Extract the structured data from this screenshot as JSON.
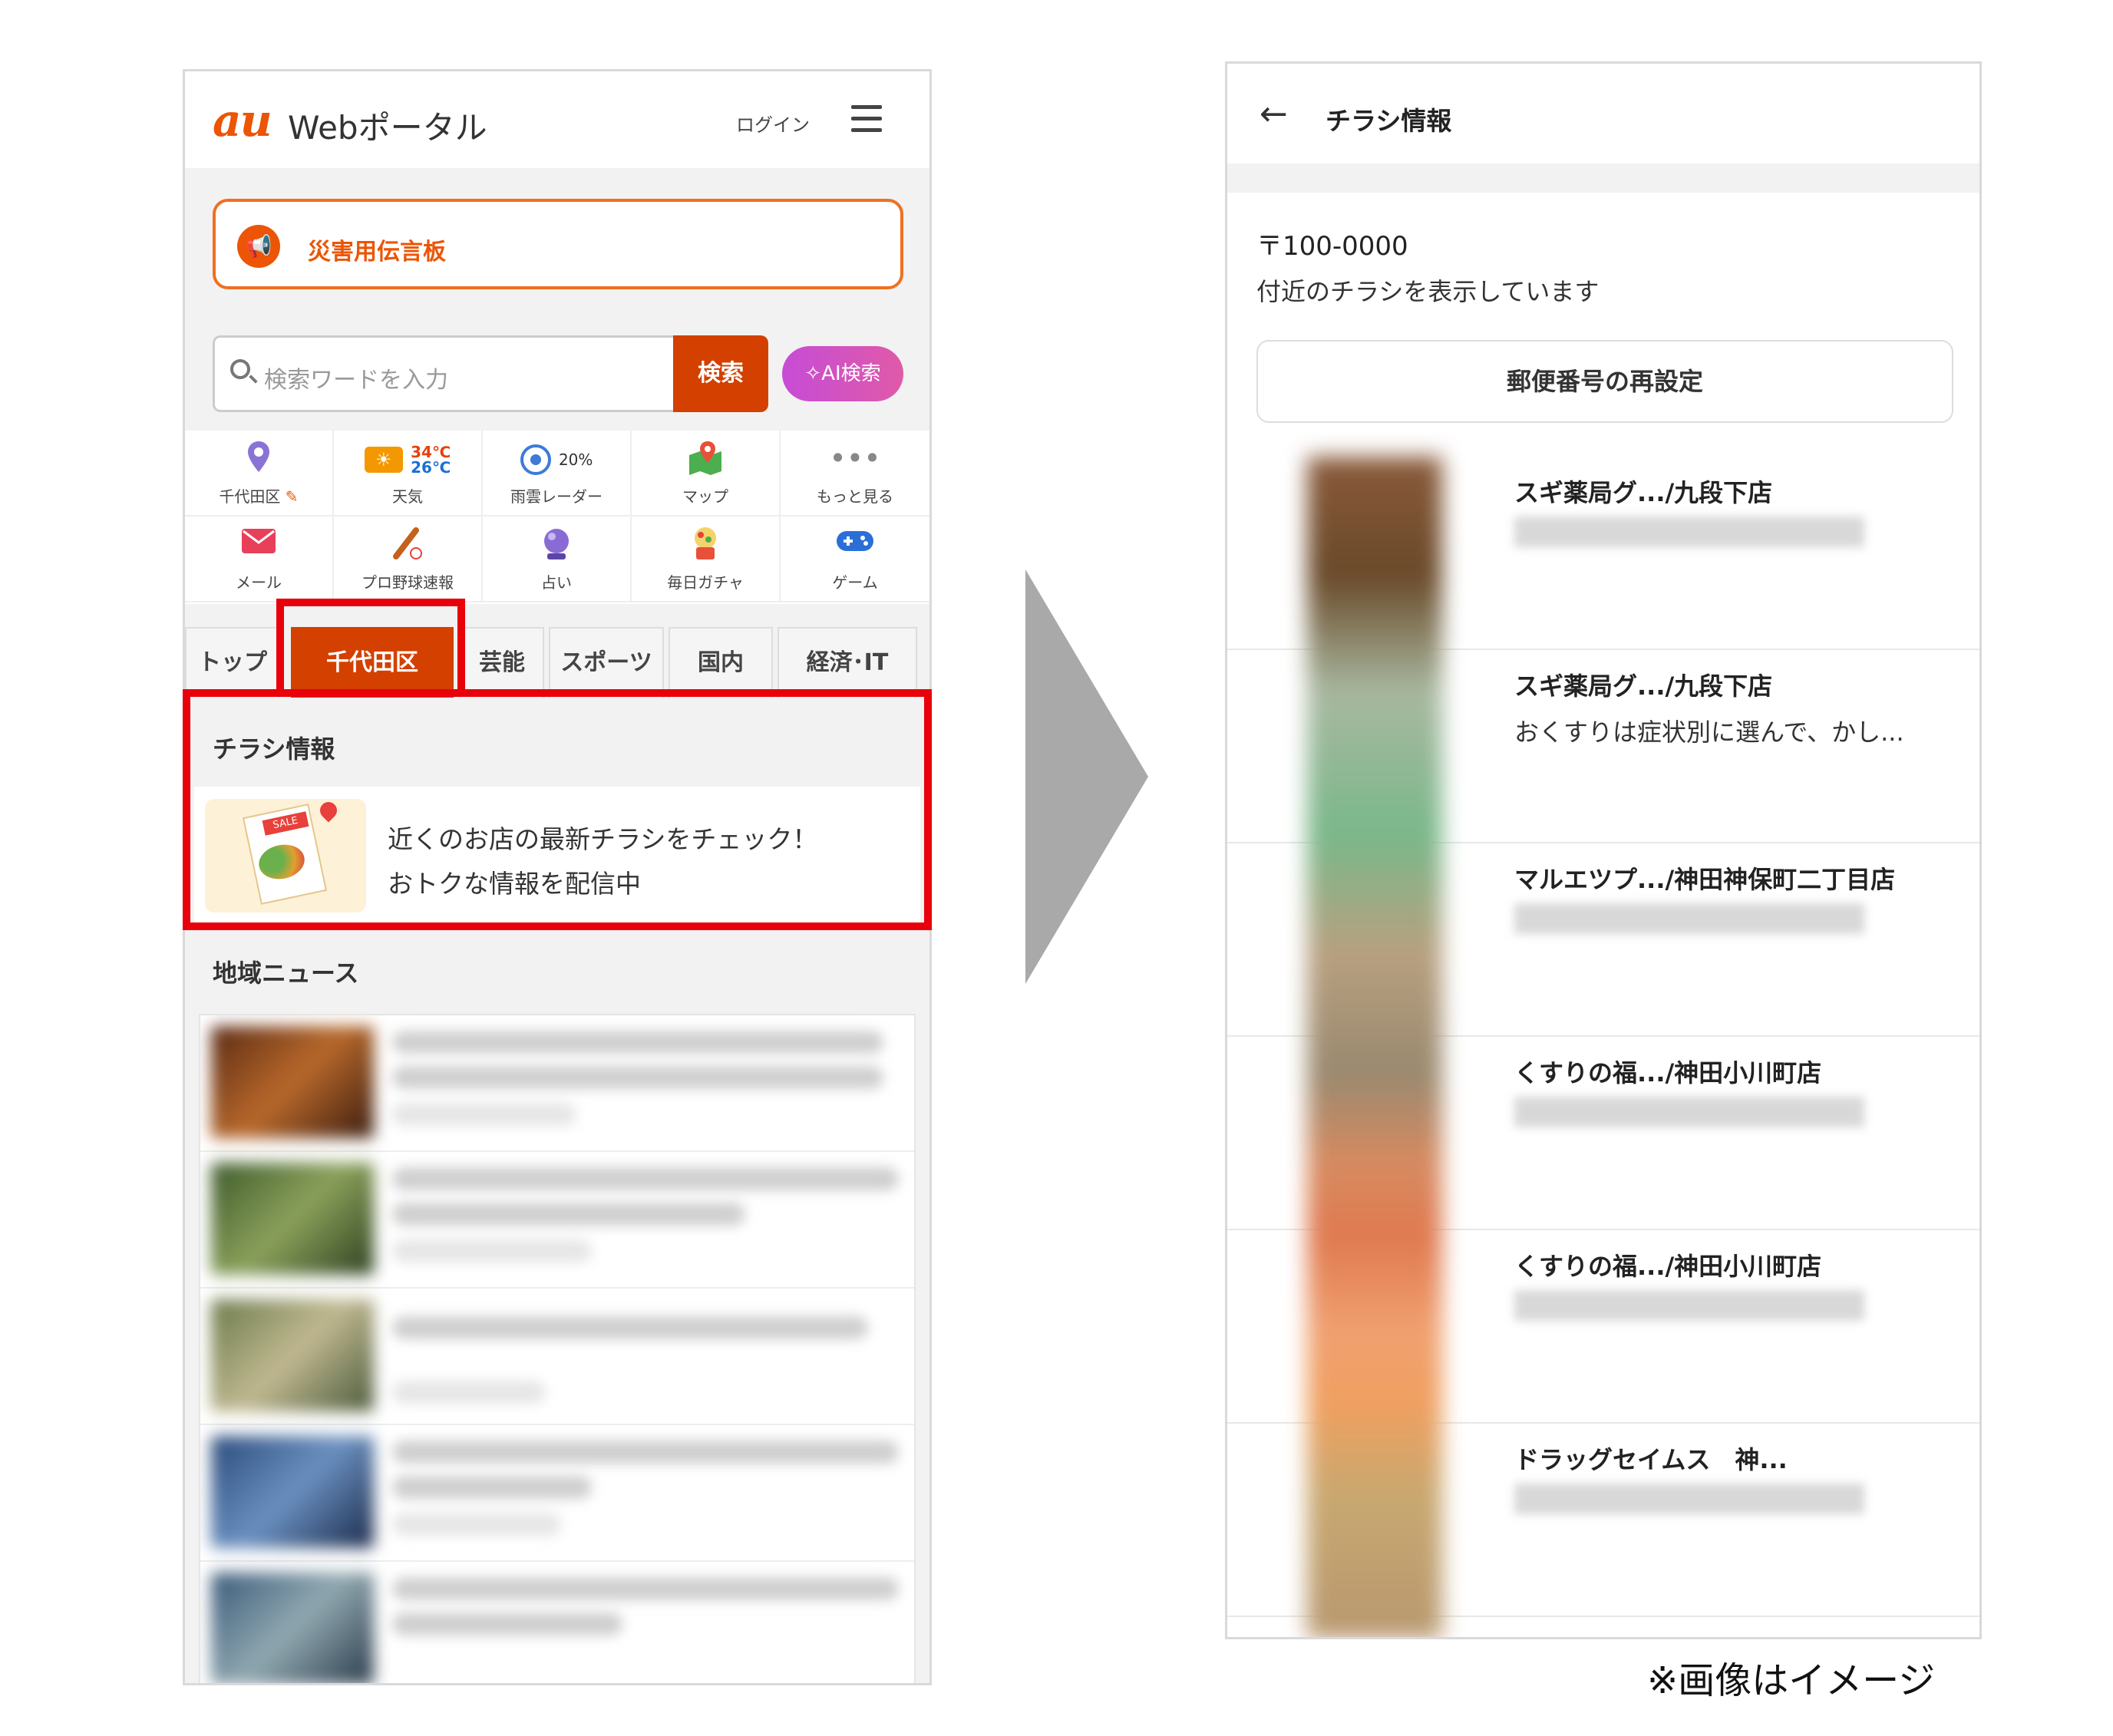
{
  "left": {
    "logo_au": "au",
    "logo_web": "Webポータル",
    "login_label": "ログイン",
    "disaster_label": "災害用伝言板",
    "search": {
      "placeholder": "検索ワードを入力",
      "button": "検索",
      "ai_button": "✧AI検索"
    },
    "weather": {
      "high": "34℃",
      "low": "26℃",
      "rain": "20%"
    },
    "grid": [
      {
        "label": "千代田区",
        "icon": "location-pin-icon"
      },
      {
        "label": "天気",
        "icon": "sun-icon"
      },
      {
        "label": "雨雲レーダー",
        "icon": "radar-icon"
      },
      {
        "label": "マップ",
        "icon": "map-icon"
      },
      {
        "label": "もっと見る",
        "icon": "more-icon"
      },
      {
        "label": "メール",
        "icon": "mail-icon"
      },
      {
        "label": "プロ野球速報",
        "icon": "baseball-icon"
      },
      {
        "label": "占い",
        "icon": "crystal-ball-icon"
      },
      {
        "label": "毎日ガチャ",
        "icon": "gacha-icon"
      },
      {
        "label": "ゲーム",
        "icon": "gamepad-icon"
      }
    ],
    "tabs": [
      "トップ",
      "千代田区",
      "芸能",
      "スポーツ",
      "国内",
      "経済･IT"
    ],
    "active_tab": "千代田区",
    "flyer": {
      "heading": "チラシ情報",
      "sale_tag": "SALE",
      "line1": "近くのお店の最新チラシをチェック！",
      "line2": "おトクな情報を配信中"
    },
    "news_heading": "地域ニュース"
  },
  "right": {
    "title": "チラシ情報",
    "postal": "〒100-0000",
    "postal_desc": "付近のチラシを表示しています",
    "reset_button": "郵便番号の再設定",
    "stores": [
      {
        "name": "スギ薬局グ.../九段下店",
        "desc": ""
      },
      {
        "name": "スギ薬局グ.../九段下店",
        "desc": "おくすりは症状別に選んで、かし..."
      },
      {
        "name": "マルエツプ.../神田神保町二丁目店",
        "desc": ""
      },
      {
        "name": "くすりの福.../神田小川町店",
        "desc": ""
      },
      {
        "name": "くすりの福.../神田小川町店",
        "desc": ""
      },
      {
        "name": "ドラッグセイムス　神...",
        "desc": ""
      }
    ]
  },
  "note": "※画像はイメージ",
  "colors": {
    "accent": "#eb5505",
    "active_tab": "#d34000",
    "highlight": "#e8000a",
    "arrow": "#a9a9a9"
  }
}
